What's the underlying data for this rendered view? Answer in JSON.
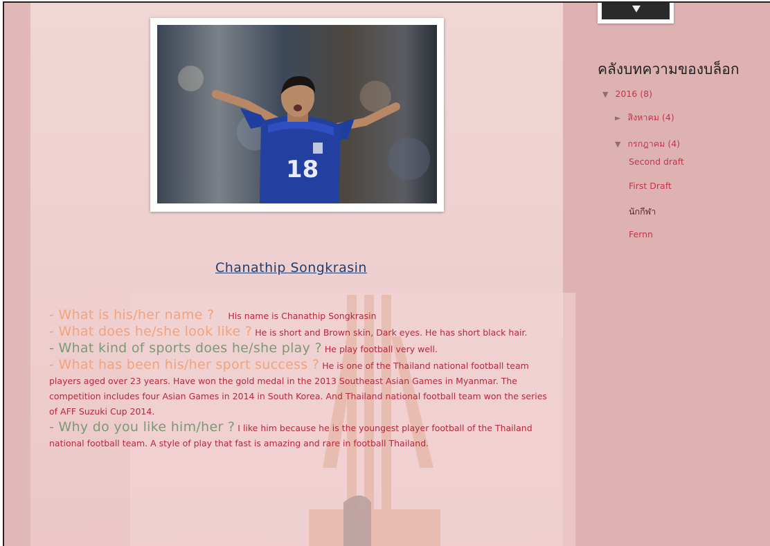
{
  "post": {
    "title": "Chanathip  Songkrasin",
    "qa": [
      {
        "question": "- What  is his/her  name ?",
        "answer": "His name is  Chanathip  Songkrasin",
        "color": "orange"
      },
      {
        "question": "- What  does he/she look like ?",
        "answer": "He is short and Brown skin,  Dark eyes. He has short black hair.",
        "color": "orange"
      },
      {
        "question": "- What kind of sports does he/she play ?",
        "answer": "He play football very  well.",
        "color": "green"
      },
      {
        "question": "- What has been his/her sport success ?",
        "answer": "He is one of the  Thailand national football team players aged over 23 years. Have won the gold medal in the 2013 Southeast Asian Games  in Myanmar. The competition includes four Asian Games in  2014 in South Korea. And Thailand  national football team won the series of  AFF Suzuki Cup 2014.",
        "color": "orange"
      },
      {
        "question": "- Why do you like him/her ?",
        "answer": "I like him because he is the youngest player football of the Thailand national football team. A style of play that fast is amazing  and rare in football Thailand.",
        "color": "green"
      }
    ],
    "photo_jersey_number": "18"
  },
  "sidebar": {
    "archive_title": "คลังบทความของบล็อก",
    "year": {
      "label": "2016",
      "count": "(8)",
      "expanded": true
    },
    "months": [
      {
        "label": "สิงหาคม",
        "count": "(4)",
        "expanded": false
      },
      {
        "label": "กรกฎาคม",
        "count": "(4)",
        "expanded": true
      }
    ],
    "posts": [
      {
        "label": "Second draft",
        "active": false
      },
      {
        "label": "First Draft",
        "active": false
      },
      {
        "label": "นักกีฬา",
        "active": true
      },
      {
        "label": "Fernn",
        "active": false
      }
    ]
  },
  "icons": {
    "expanded": "triangle-down-icon",
    "collapsed": "triangle-right-icon"
  },
  "colors": {
    "link": "#c2334c",
    "answer_text": "#b7273d",
    "question_orange": "#f1a37c",
    "question_green": "#7b9a73",
    "title_link": "#1f3e6e"
  }
}
